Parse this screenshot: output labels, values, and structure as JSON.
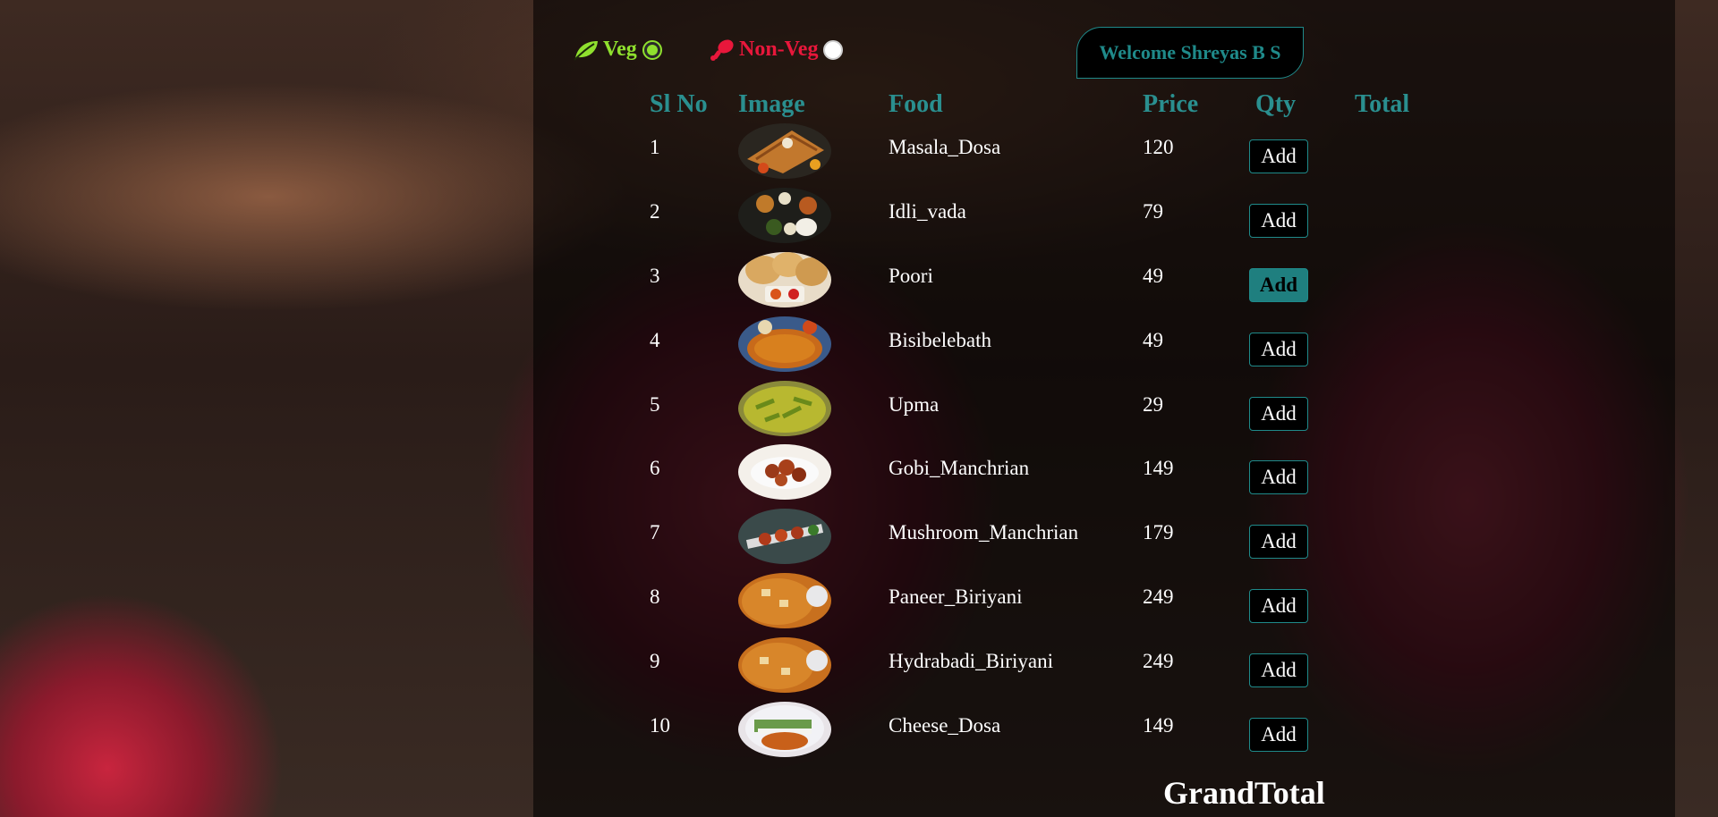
{
  "filters": {
    "veg": "Veg",
    "nonveg": "Non-Veg"
  },
  "welcome": "Welcome Shreyas B S",
  "headers": [
    "Sl No",
    "Image",
    "Food",
    "Price",
    "Qty",
    "Total"
  ],
  "rows": [
    {
      "sl": "1",
      "food": "Masala_Dosa",
      "price": "120",
      "qty": "Add",
      "thumb": "dosa-thumbnail"
    },
    {
      "sl": "2",
      "food": "Idli_vada",
      "price": "79",
      "qty": "Add",
      "thumb": "idli-vada-thumbnail"
    },
    {
      "sl": "3",
      "food": "Poori",
      "price": "49",
      "qty": "Add",
      "thumb": "poori-thumbnail"
    },
    {
      "sl": "4",
      "food": "Bisibelebath",
      "price": "49",
      "qty": "Add",
      "thumb": "bisibelebath-thumbnail"
    },
    {
      "sl": "5",
      "food": "Upma",
      "price": "29",
      "qty": "Add",
      "thumb": "upma-thumbnail"
    },
    {
      "sl": "6",
      "food": "Gobi_Manchrian",
      "price": "149",
      "qty": "Add",
      "thumb": "gobi-manchurian-thumbnail"
    },
    {
      "sl": "7",
      "food": "Mushroom_Manchrian",
      "price": "179",
      "qty": "Add",
      "thumb": "mushroom-manchurian-thumbnail"
    },
    {
      "sl": "8",
      "food": "Paneer_Biriyani",
      "price": "249",
      "qty": "Add",
      "thumb": "paneer-biriyani-thumbnail"
    },
    {
      "sl": "9",
      "food": "Hydrabadi_Biriyani",
      "price": "249",
      "qty": "Add",
      "thumb": "hydrabadi-biriyani-thumbnail"
    },
    {
      "sl": "10",
      "food": "Cheese_Dosa",
      "price": "149",
      "qty": "Add",
      "thumb": "cheese-dosa-thumbnail"
    }
  ],
  "grand_total": "GrandTotal",
  "colors": {
    "veg": "#8fe02e",
    "nonveg": "#e8173b",
    "accent": "#1f8a8a"
  },
  "icons": {
    "veg": "leaf-icon",
    "nonveg": "drumstick-icon"
  }
}
